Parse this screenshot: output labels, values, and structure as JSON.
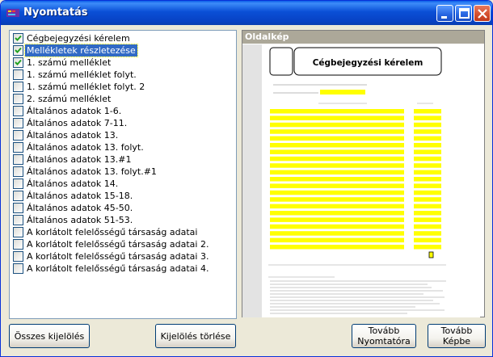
{
  "window": {
    "title": "Nyomtatás"
  },
  "items": [
    {
      "label": "Cégbejegyzési kérelem",
      "checked": true,
      "selected": false
    },
    {
      "label": "Mellékletek részletezése",
      "checked": true,
      "selected": true
    },
    {
      "label": "1. számú melléklet",
      "checked": true,
      "selected": false
    },
    {
      "label": "1. számú melléklet folyt.",
      "checked": false,
      "selected": false
    },
    {
      "label": "1. számú melléklet folyt. 2",
      "checked": false,
      "selected": false
    },
    {
      "label": "2. számú melléklet",
      "checked": false,
      "selected": false
    },
    {
      "label": "Általános adatok 1-6.",
      "checked": false,
      "selected": false
    },
    {
      "label": "Általános adatok 7-11.",
      "checked": false,
      "selected": false
    },
    {
      "label": "Általános adatok 13.",
      "checked": false,
      "selected": false
    },
    {
      "label": "Általános adatok 13. folyt.",
      "checked": false,
      "selected": false
    },
    {
      "label": "Általános adatok 13.#1",
      "checked": false,
      "selected": false
    },
    {
      "label": "Általános adatok 13. folyt.#1",
      "checked": false,
      "selected": false
    },
    {
      "label": "Általános adatok 14.",
      "checked": false,
      "selected": false
    },
    {
      "label": "Általános adatok 15-18.",
      "checked": false,
      "selected": false
    },
    {
      "label": "Általános adatok 45-50.",
      "checked": false,
      "selected": false
    },
    {
      "label": "Általános adatok 51-53.",
      "checked": false,
      "selected": false
    },
    {
      "label": "A korlátolt felelősségű társaság adatai",
      "checked": false,
      "selected": false
    },
    {
      "label": "A korlátolt felelősségű társaság adatai 2.",
      "checked": false,
      "selected": false
    },
    {
      "label": "A korlátolt felelősségű társaság adatai 3.",
      "checked": false,
      "selected": false
    },
    {
      "label": "A korlátolt felelősségű társaság adatai 4.",
      "checked": false,
      "selected": false
    }
  ],
  "preview": {
    "header": "Oldalkép",
    "doc_title": "Cégbejegyzési kérelem"
  },
  "buttons": {
    "select_all": "Összes kijelölés",
    "clear_selection": "Kijelölés törlése",
    "to_printer": "Tovább\nNyomtatóra",
    "to_image": "Tovább\nKépbe"
  },
  "colors": {
    "title_bar": "#0a4fd6",
    "selection": "#316ac5",
    "highlight_field": "#ffff00"
  }
}
